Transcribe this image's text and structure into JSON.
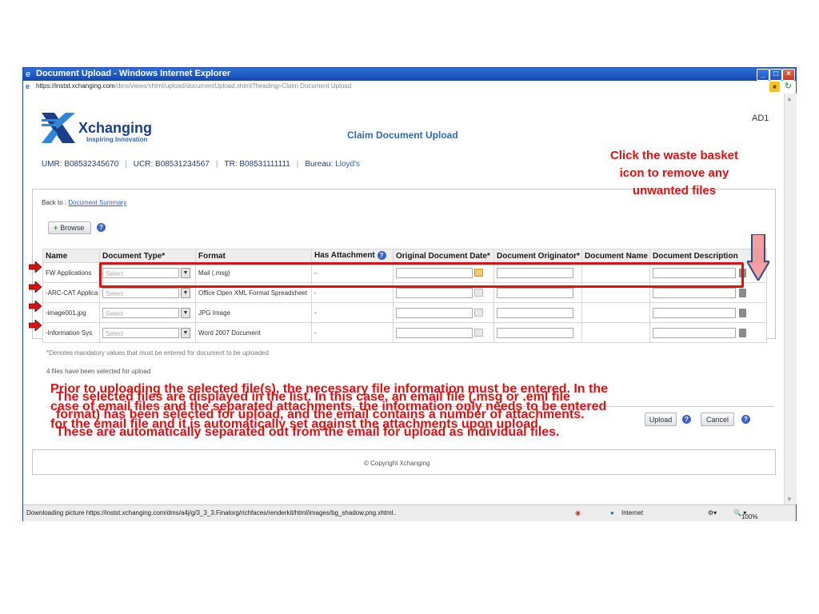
{
  "window": {
    "title": "Document Upload - Windows Internet Explorer",
    "url_host": "https://instst.xchanging.com",
    "url_path": "/dms/views/xhtml/upload/documentUpload.xhtml?heading=Claim Document Upload"
  },
  "header": {
    "logo_name": "Xchanging",
    "logo_tagline": "Inspiring Innovation",
    "page_title": "Claim Document Upload",
    "user_code": "AD1",
    "refs": {
      "umr": "UMR: B08532345670",
      "ucr": "UCR: B08531234567",
      "tr": "TR: B08531111111",
      "bureau_label": "Bureau:",
      "bureau_value": "Lloyd's"
    }
  },
  "panel": {
    "back_to_label": "Back to :",
    "back_to_link": "Document Summary",
    "browse_label": "Browse"
  },
  "table": {
    "columns": [
      "Name",
      "Document Type*",
      "Format",
      "Has Attachment",
      "Original Document Date*",
      "Document Originator*",
      "Document Name",
      "Document Description"
    ],
    "select_placeholder": "Select",
    "rows": [
      {
        "name": "FW Applications",
        "format": "Mail (.msg)",
        "has_attachment": "-"
      },
      {
        "name": "-ARC-CAT Applica",
        "format": "Office Open XML Format Spreadsheet",
        "has_attachment": "-"
      },
      {
        "name": "-image001.jpg",
        "format": "JPG Image",
        "has_attachment": "-"
      },
      {
        "name": "-Information Sys",
        "format": "Word 2007 Document",
        "has_attachment": "-"
      }
    ]
  },
  "notes": {
    "mandatory": "*Denotes mandatory values that must be entered for document to be uploaded",
    "file_count": "4 files have been selected for upload"
  },
  "actions": {
    "upload_label": "Upload",
    "cancel_label": "Cancel"
  },
  "footer": {
    "copyright": "© Copyright Xchanging"
  },
  "statusbar": {
    "message": "Downloading picture https://instst.xchanging.com/dms/a4j/g/3_3_3.Finalorg/richfaces/renderkit/html/images/bg_shadow.png.xhtml..",
    "zone": "Internet",
    "zoom": "100%"
  },
  "annotations": {
    "right_callout": "Click the waste basket icon to remove any unwanted files",
    "bottom_callout_1": "Prior to uploading the selected file(s), the necessary file information must be entered. In the case of email files and the separated attachments, the information only needs to be entered for the email file and it is automatically set against the attachments upon upload.",
    "bottom_callout_2": "The selected files are displayed in the list. In this case, an email file (.msg or .eml file format) has been selected for upload, and the email contains a number of attachments. These are automatically separated out from the email for upload as individual files."
  },
  "colors": {
    "annotation_red": "#e01010",
    "title_blue": "#2f68b4",
    "titlebar_blue": "#1546b0"
  }
}
